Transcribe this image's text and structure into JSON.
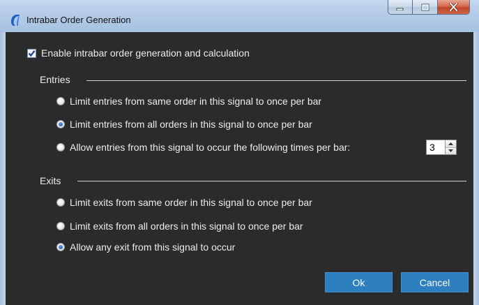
{
  "window": {
    "title": "Intrabar Order Generation",
    "icon": "app-logo-icon"
  },
  "caption_buttons": [
    "minimize-icon",
    "maximize-icon",
    "close-icon"
  ],
  "enable": {
    "label": "Enable intrabar order generation and calculation",
    "checked": true
  },
  "entries": {
    "label": "Entries",
    "options": [
      {
        "label": "Limit entries from same order in this signal to once per bar",
        "selected": false
      },
      {
        "label": "Limit entries from all orders in this signal to once per bar",
        "selected": true
      },
      {
        "label": "Allow entries from this signal to occur the following times per bar:",
        "selected": false
      }
    ],
    "times_per_bar": "3"
  },
  "exits": {
    "label": "Exits",
    "options": [
      {
        "label": "Limit exits from same order in this signal to once per bar",
        "selected": false
      },
      {
        "label": "Limit exits from all orders in this signal to once per bar",
        "selected": false
      },
      {
        "label": "Allow any exit from this signal to occur",
        "selected": true
      }
    ]
  },
  "buttons": {
    "ok": "Ok",
    "cancel": "Cancel"
  },
  "colors": {
    "background": "#2b2b2b",
    "button": "#2d7fbf",
    "titlebar": "#b3cbe6"
  }
}
